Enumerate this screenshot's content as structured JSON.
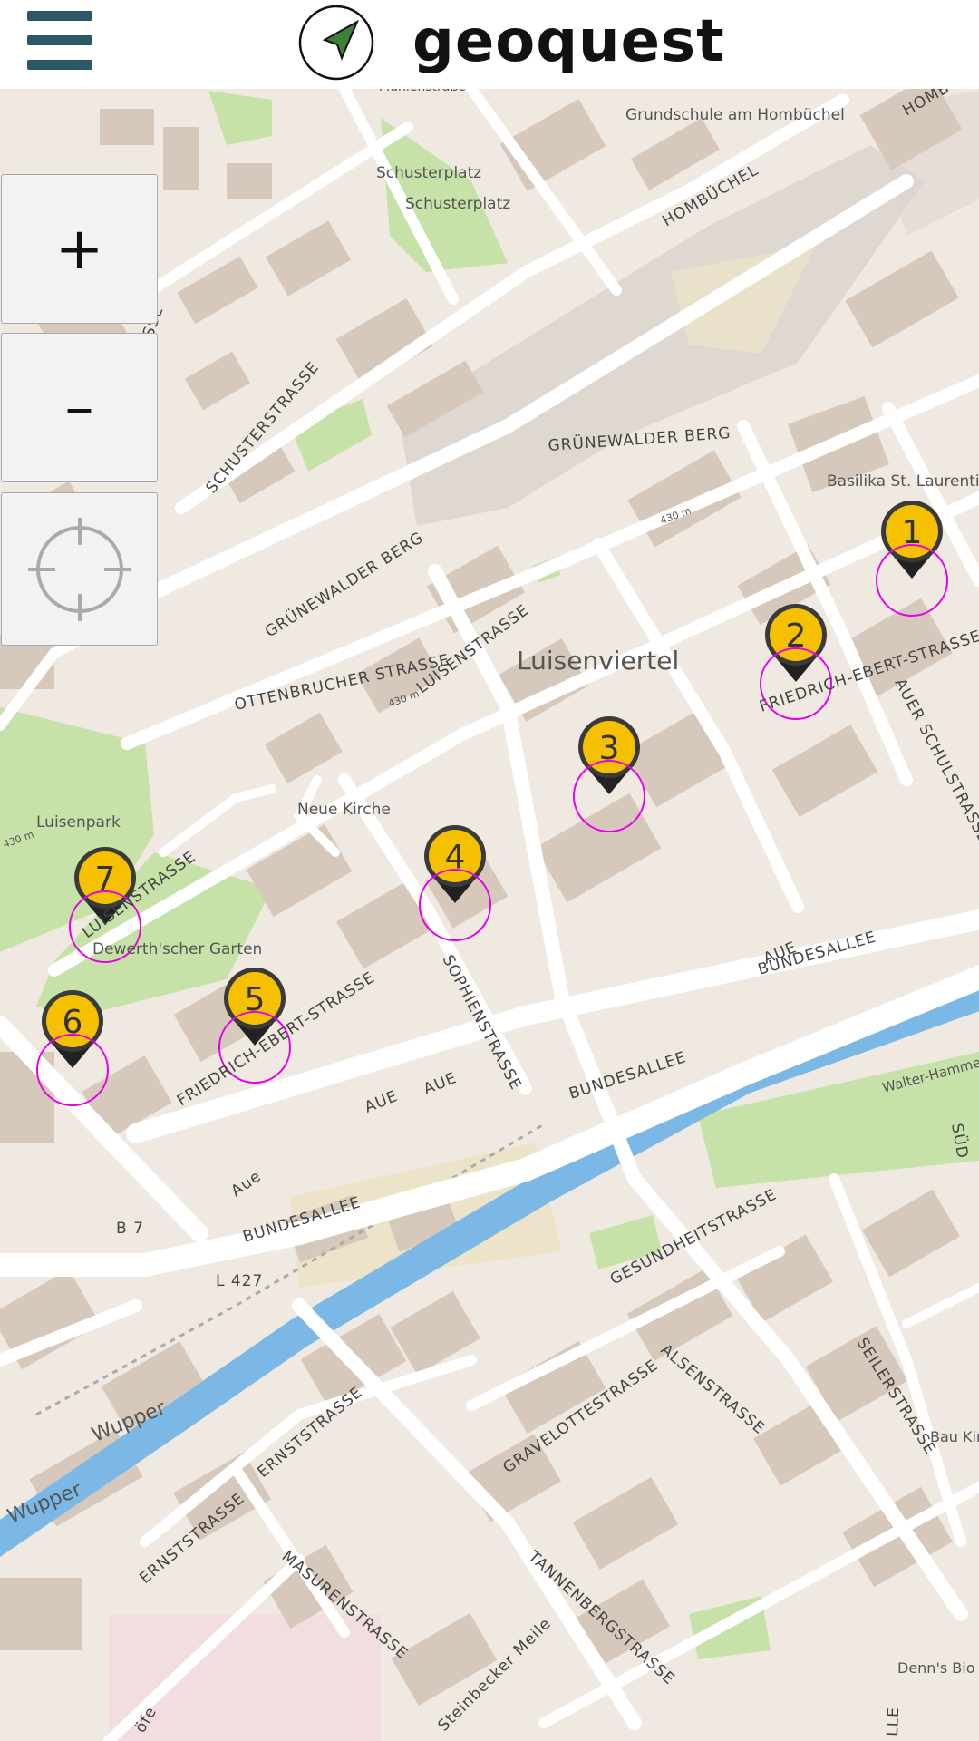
{
  "header": {
    "title": "geoquest",
    "menu_icon": "hamburger-menu-icon",
    "logo_icon": "navigation-arrow-icon",
    "accent_color": "#2c5865",
    "logo_arrow_color": "#3f7d3a"
  },
  "map_controls": {
    "zoom_in_label": "+",
    "zoom_out_label": "–",
    "locate_icon": "crosshair-icon"
  },
  "map": {
    "place_labels": [
      "Luisenviertel",
      "Luisenpark",
      "Neue Kirche",
      "Dewerth'scher Garten",
      "Schusterplatz",
      "Schusterplatz",
      "Grundschule am Hombüchel",
      "Basilika St. Laurentius",
      "Walter-Hammer",
      "Bau Kin",
      "Denn's Bio",
      "Wupper",
      "Wupper",
      "Mühlenstraße",
      "430 m",
      "430 m",
      "430 m"
    ],
    "street_labels": [
      "GRÜNEWALDER BERG",
      "GRÜNEWALDER BERG",
      "SCHUSTERSTRASSE",
      "OTTENBRUCHER STRASSE",
      "LUISENSTRASSE",
      "LUISENSTRASSE",
      "FRIEDRICH-EBERT-STRASSE",
      "FRIEDRICH-EBERT-STRASSE",
      "AUER SCHULSTRASSE",
      "SOPHIENSTRASSE",
      "BUNDESALLEE",
      "BUNDESALLEE",
      "BUNDESALLEE",
      "AUE",
      "AUE",
      "AUE",
      "Aue",
      "HOMBÜCHEL",
      "HOMBÜ",
      "GESUNDHEITSTRASSE",
      "ALSENSTRASSE",
      "SEILERSTRASSE",
      "GRAVELOTTESTRASSE",
      "ERNSTSTRASSE",
      "ERNSTSTRASSE",
      "MASURENSTRASSE",
      "TANNENBERGSTRASSE",
      "Steinbecker Meile",
      "SSE",
      "SÜD",
      "LLE",
      "öfe",
      "B 7",
      "L 427"
    ],
    "markers": [
      {
        "label": "1",
        "color": "#f5c000"
      },
      {
        "label": "2",
        "color": "#f5c000"
      },
      {
        "label": "3",
        "color": "#f5c000"
      },
      {
        "label": "4",
        "color": "#f5c000"
      },
      {
        "label": "5",
        "color": "#f5c000"
      },
      {
        "label": "6",
        "color": "#f5c000"
      },
      {
        "label": "7",
        "color": "#f5c000"
      }
    ],
    "geofence_color": "#e600e6",
    "colors": {
      "building": "#d6c8ba",
      "park": "#c7e2a8",
      "river": "#7bb8e6",
      "road": "#ffffff",
      "background": "#f0e9e2"
    }
  }
}
